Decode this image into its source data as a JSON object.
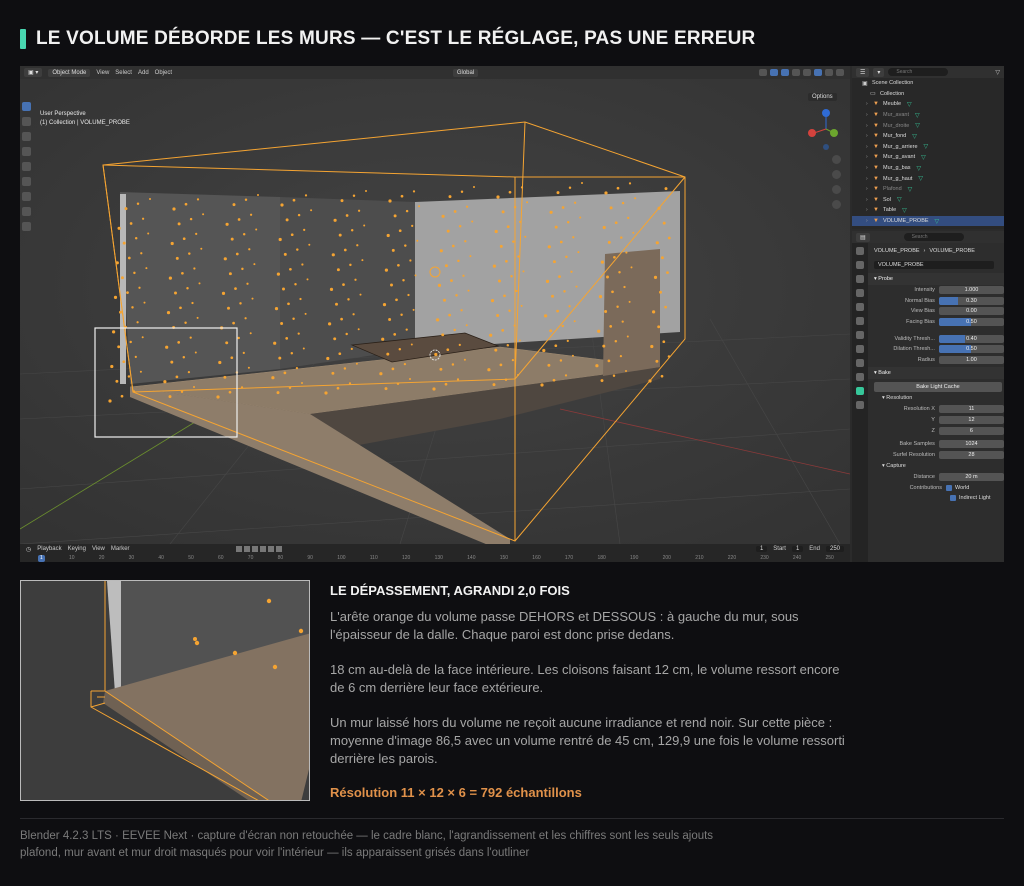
{
  "heading": "LE VOLUME DÉBORDE LES MURS — C'EST LE RÉGLAGE, PAS UNE ERREUR",
  "colors": {
    "accent": "#48d6b0",
    "orange": "#e0914a",
    "probe_orange": "#f5a432",
    "selection_blue": "#334d80"
  },
  "viewport": {
    "mode": "Object Mode",
    "menus": [
      "View",
      "Select",
      "Add",
      "Object"
    ],
    "transform": "Global",
    "options": "Options",
    "info_line1": "User Perspective",
    "info_line2": "(1) Collection | VOLUME_PROBE"
  },
  "timeline": {
    "menus": [
      "Playback",
      "Keying",
      "View",
      "Marker"
    ],
    "current_frame": "1",
    "start_label": "Start",
    "start": "1",
    "end_label": "End",
    "end": "250",
    "ruler": [
      "1",
      "10",
      "20",
      "30",
      "40",
      "50",
      "60",
      "70",
      "80",
      "90",
      "100",
      "110",
      "120",
      "130",
      "140",
      "150",
      "160",
      "170",
      "180",
      "190",
      "200",
      "210",
      "220",
      "230",
      "240",
      "250"
    ]
  },
  "outliner": {
    "search_placeholder": "Search",
    "scene_collection": "Scene Collection",
    "collection": "Collection",
    "items": [
      {
        "name": "Meuble",
        "dim": false,
        "selected": false
      },
      {
        "name": "Mur_avant",
        "dim": true,
        "selected": false
      },
      {
        "name": "Mur_droite",
        "dim": true,
        "selected": false
      },
      {
        "name": "Mur_fond",
        "dim": false,
        "selected": false
      },
      {
        "name": "Mur_g_arriere",
        "dim": false,
        "selected": false
      },
      {
        "name": "Mur_g_avant",
        "dim": false,
        "selected": false
      },
      {
        "name": "Mur_g_bas",
        "dim": false,
        "selected": false
      },
      {
        "name": "Mur_g_haut",
        "dim": false,
        "selected": false
      },
      {
        "name": "Plafond",
        "dim": true,
        "selected": false
      },
      {
        "name": "Sol",
        "dim": false,
        "selected": false
      },
      {
        "name": "Table",
        "dim": false,
        "selected": false
      },
      {
        "name": "VOLUME_PROBE",
        "dim": false,
        "selected": true
      }
    ]
  },
  "properties": {
    "search_placeholder": "Search",
    "crumb_object": "VOLUME_PROBE",
    "crumb_data": "VOLUME_PROBE",
    "data_name": "VOLUME_PROBE",
    "probe_panel": "Probe",
    "probe_rows": [
      {
        "label": "Intensity",
        "value": "1.000",
        "fill": 0
      },
      {
        "label": "Normal Bias",
        "value": "0.30",
        "fill": 0.3
      },
      {
        "label": "View Bias",
        "value": "0.00",
        "fill": 0
      },
      {
        "label": "Facing Bias",
        "value": "0.50",
        "fill": 0.5
      },
      {
        "label": "Validity Thresh...",
        "value": "0.40",
        "fill": 0.4
      },
      {
        "label": "Dilation Thresh...",
        "value": "0.50",
        "fill": 0.5
      },
      {
        "label": "Radius",
        "value": "1.00",
        "fill": 0
      }
    ],
    "bake_panel": "Bake",
    "bake_button": "Bake Light Cache",
    "resolution_panel": "Resolution",
    "resolution_rows": [
      {
        "label": "Resolution X",
        "value": "11"
      },
      {
        "label": "Y",
        "value": "12"
      },
      {
        "label": "Z",
        "value": "6"
      },
      {
        "label": "Bake Samples",
        "value": "1024"
      },
      {
        "label": "Surfel Resolution",
        "value": "28"
      }
    ],
    "capture_panel": "Capture",
    "distance_label": "Distance",
    "distance": "20 m",
    "contributions_label": "Contributions",
    "world": "World",
    "indirect": "Indirect Light"
  },
  "detail": {
    "title": "LE DÉPASSEMENT, AGRANDI 2,0 FOIS",
    "p1": "L'arête orange du volume passe DEHORS et DESSOUS : à gauche du mur, sous l'épaisseur de la dalle. Chaque paroi est donc prise dedans.",
    "p2": "18 cm au-delà de la face intérieure. Les cloisons faisant 12 cm, le volume ressort encore de 6 cm derrière leur face extérieure.",
    "p3": "Un mur laissé hors du volume ne reçoit aucune irradiance et rend noir. Sur cette pièce : moyenne d'image 86,5 avec un volume rentré de 45 cm, 129,9 une fois le volume ressorti derrière les parois.",
    "resolution": "Résolution  11 × 12 × 6 = 792 échantillons"
  },
  "footer": {
    "line1": "Blender 4.2.3 LTS · EEVEE Next · capture d'écran non retouchée — le cadre blanc, l'agrandissement et les chiffres sont les seuls ajouts",
    "line2": "plafond, mur avant et mur droit masqués pour voir l'intérieur — ils apparaissent grisés dans l'outliner"
  }
}
